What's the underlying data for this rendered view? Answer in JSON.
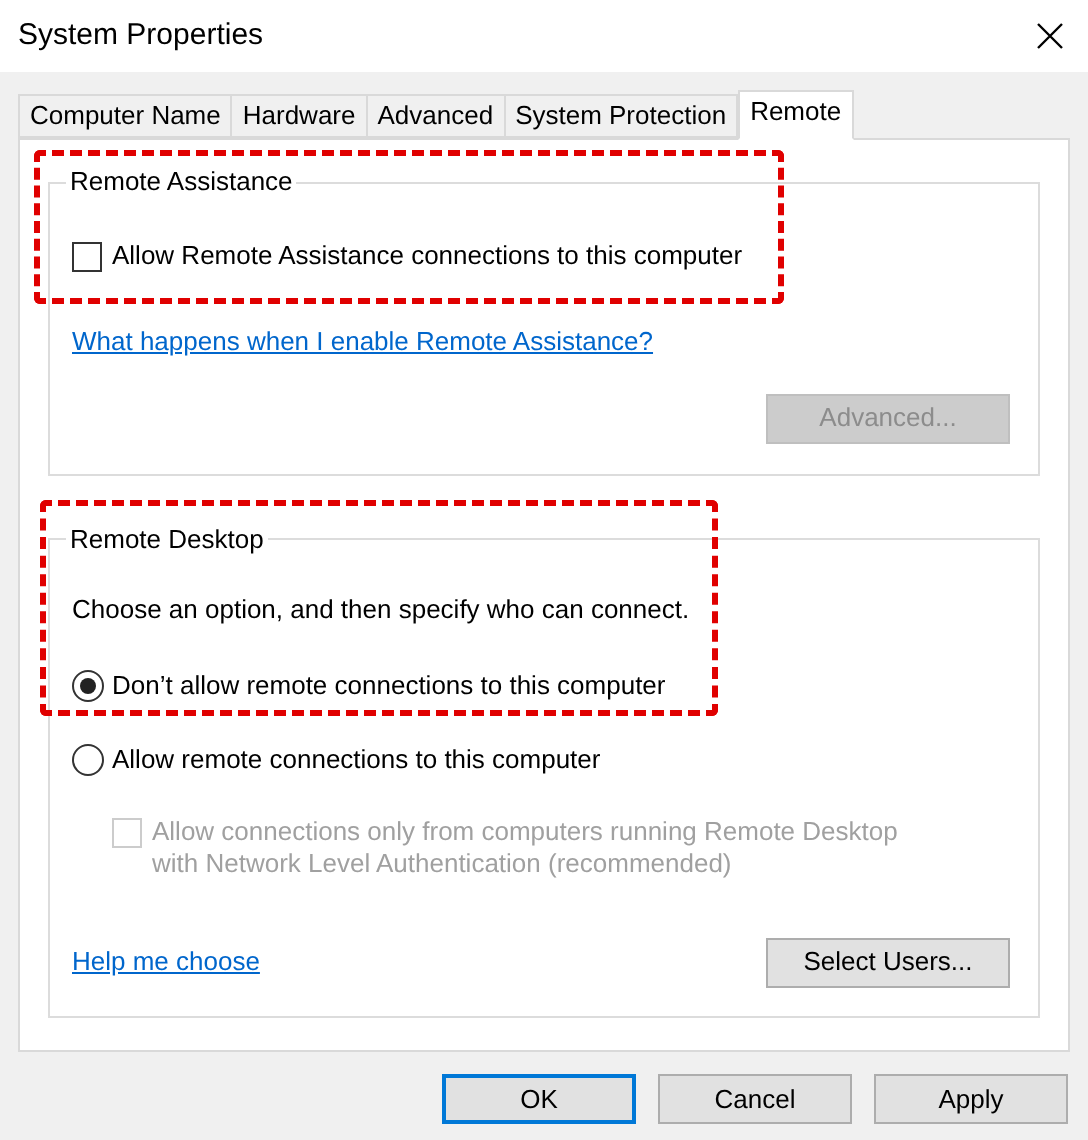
{
  "window": {
    "title": "System Properties"
  },
  "tabs": [
    {
      "label": "Computer Name",
      "selected": false
    },
    {
      "label": "Hardware",
      "selected": false
    },
    {
      "label": "Advanced",
      "selected": false
    },
    {
      "label": "System Protection",
      "selected": false
    },
    {
      "label": "Remote",
      "selected": true
    }
  ],
  "remote_assistance": {
    "title": "Remote Assistance",
    "checkbox": {
      "label": "Allow Remote Assistance connections to this computer",
      "checked": false
    },
    "link": "What happens when I enable Remote Assistance?",
    "advanced_button": {
      "label": "Advanced...",
      "disabled": true
    }
  },
  "remote_desktop": {
    "title": "Remote Desktop",
    "instruction": "Choose an option, and then specify who can connect.",
    "options": [
      {
        "label": "Don’t allow remote connections to this computer",
        "selected": true
      },
      {
        "label": "Allow remote connections to this computer",
        "selected": false
      }
    ],
    "nla_checkbox": {
      "label": "Allow connections only from computers running Remote Desktop with Network Level Authentication (recommended)",
      "checked": false,
      "disabled": true
    },
    "help_link": "Help me choose",
    "select_users_button": {
      "label": "Select Users...",
      "disabled": false
    }
  },
  "buttons": [
    {
      "label": "OK",
      "default": true
    },
    {
      "label": "Cancel",
      "default": false
    },
    {
      "label": "Apply",
      "default": false
    }
  ]
}
